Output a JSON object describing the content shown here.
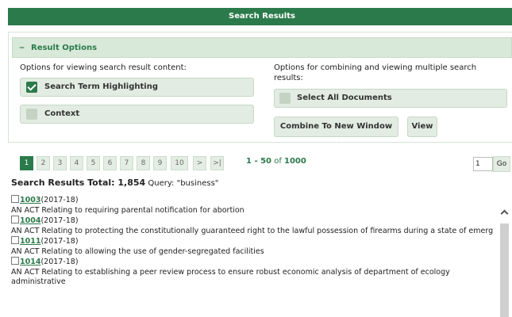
{
  "header": {
    "title": "Search Results"
  },
  "options": {
    "section_title": "Result Options",
    "left_label": "Options for viewing search result content:",
    "right_label": "Options for combining and viewing multiple search results:",
    "search_term_highlighting": "Search Term Highlighting",
    "context": "Context",
    "select_all_documents": "Select All Documents",
    "combine_dropdown": "Combine To New Window",
    "view_button": "View"
  },
  "pager": {
    "pages": [
      "1",
      "2",
      "3",
      "4",
      "5",
      "6",
      "7",
      "8",
      "9",
      "10"
    ],
    "next": ">",
    "last": ">|",
    "range_start": "1",
    "range_sep": " - ",
    "range_end": "50",
    "of_text": " of ",
    "range_total": "1000",
    "page_input": "1",
    "go": "Go"
  },
  "summary": {
    "label": "Search Results Total: 1,854",
    "query": " Query: \"business\""
  },
  "results": [
    {
      "number": "1003",
      "session": "(2017-18)",
      "title": "AN ACT Relating to requiring parental notification for abortion"
    },
    {
      "number": "1004",
      "session": "(2017-18)",
      "title": "AN ACT Relating to protecting the constitutionally guaranteed right to the lawful possession of firearms during a state of emerg"
    },
    {
      "number": "1011",
      "session": "(2017-18)",
      "title": "AN ACT Relating to allowing the use of gender-segregated facilities"
    },
    {
      "number": "1014",
      "session": "(2017-18)",
      "title": "AN ACT Relating to establishing a peer review process to ensure robust economic analysis of department of ecology administrative"
    }
  ]
}
